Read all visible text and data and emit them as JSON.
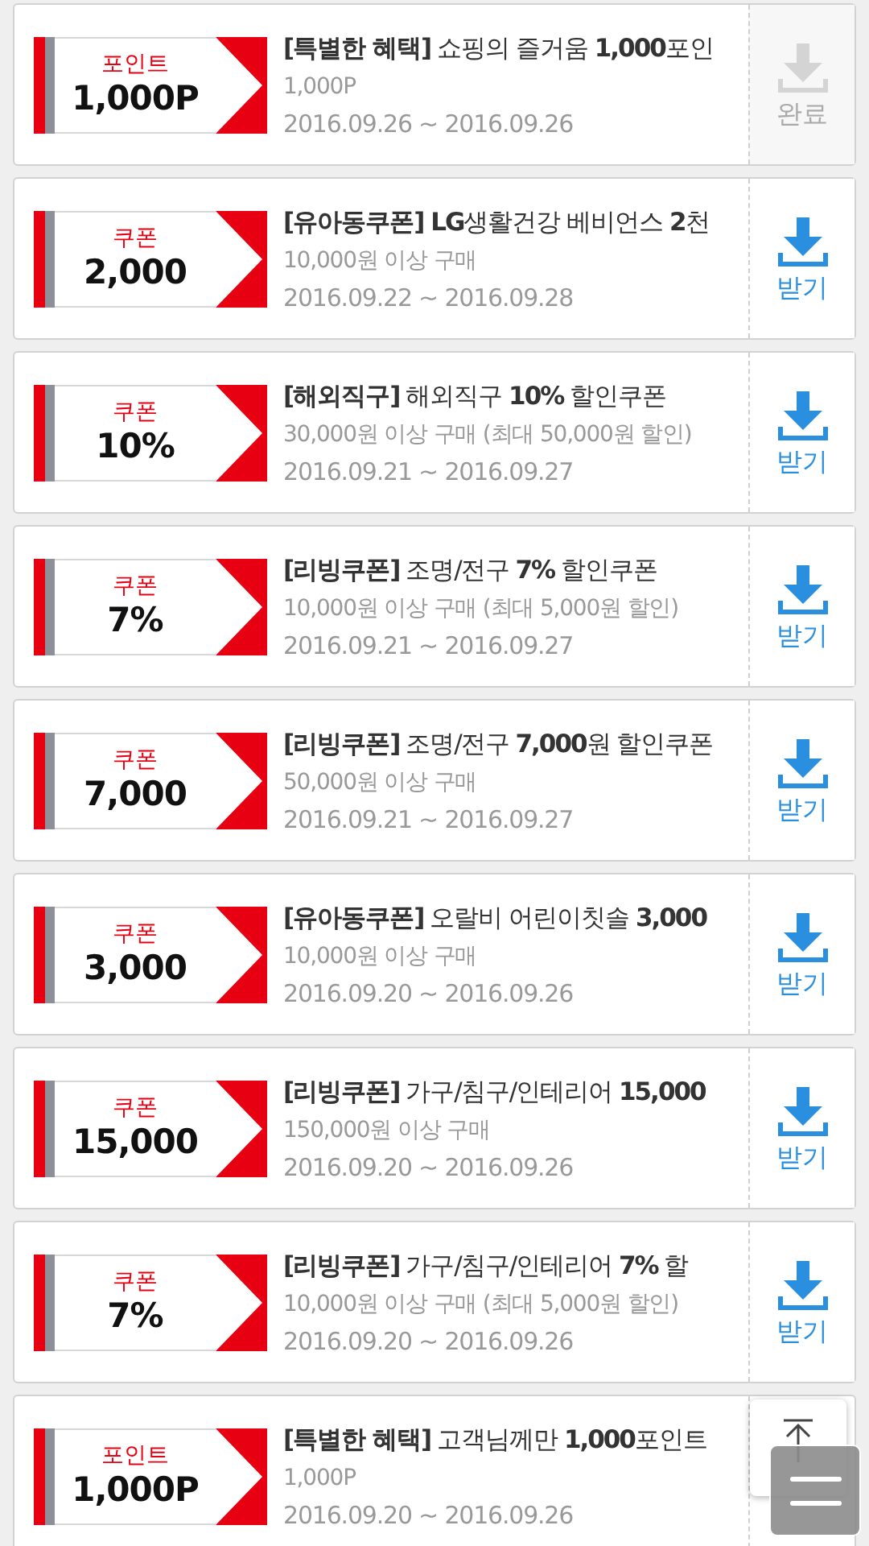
{
  "coupons": [
    {
      "type": "포인트",
      "value": "1,000P",
      "title": "**[특별한 혜택]** 쇼핑의 즐거움 **1,000**포인",
      "condition": "1,000P",
      "period": "2016.09.26 ~ 2016.09.26",
      "action": "완료",
      "done": true
    },
    {
      "type": "쿠폰",
      "value": "2,000",
      "title": "**[유아동쿠폰] LG**생활건강 베비언스 **2**천",
      "condition": "10,000원 이상 구매",
      "period": "2016.09.22 ~ 2016.09.28",
      "action": "받기",
      "done": false
    },
    {
      "type": "쿠폰",
      "value": "10%",
      "title": "**[해외직구]** 해외직구 **10%** 할인쿠폰",
      "condition": "30,000원 이상 구매 (최대 50,000원 할인)",
      "period": "2016.09.21 ~ 2016.09.27",
      "action": "받기",
      "done": false
    },
    {
      "type": "쿠폰",
      "value": "7%",
      "title": "**[리빙쿠폰]** 조명/전구 **7%** 할인쿠폰",
      "condition": "10,000원 이상 구매 (최대 5,000원 할인)",
      "period": "2016.09.21 ~ 2016.09.27",
      "action": "받기",
      "done": false
    },
    {
      "type": "쿠폰",
      "value": "7,000",
      "title": "**[리빙쿠폰]** 조명/전구 **7,000**원 할인쿠폰",
      "condition": "50,000원 이상 구매",
      "period": "2016.09.21 ~ 2016.09.27",
      "action": "받기",
      "done": false
    },
    {
      "type": "쿠폰",
      "value": "3,000",
      "title": "**[유아동쿠폰]** 오랄비 어린이칫솔 **3,000**",
      "condition": "10,000원 이상 구매",
      "period": "2016.09.20 ~ 2016.09.26",
      "action": "받기",
      "done": false
    },
    {
      "type": "쿠폰",
      "value": "15,000",
      "title": "**[리빙쿠폰]** 가구/침구/인테리어 **15,000**",
      "condition": "150,000원 이상 구매",
      "period": "2016.09.20 ~ 2016.09.26",
      "action": "받기",
      "done": false
    },
    {
      "type": "쿠폰",
      "value": "7%",
      "title": "**[리빙쿠폰]** 가구/침구/인테리어 **7%** 할",
      "condition": "10,000원 이상 구매 (최대 5,000원 할인)",
      "period": "2016.09.20 ~ 2016.09.26",
      "action": "받기",
      "done": false
    },
    {
      "type": "포인트",
      "value": "1,000P",
      "title": "**[특별한 혜택]** 고객님께만 **1,000**포인트",
      "condition": "1,000P",
      "period": "2016.09.20 ~ 2016.09.26"
    }
  ]
}
